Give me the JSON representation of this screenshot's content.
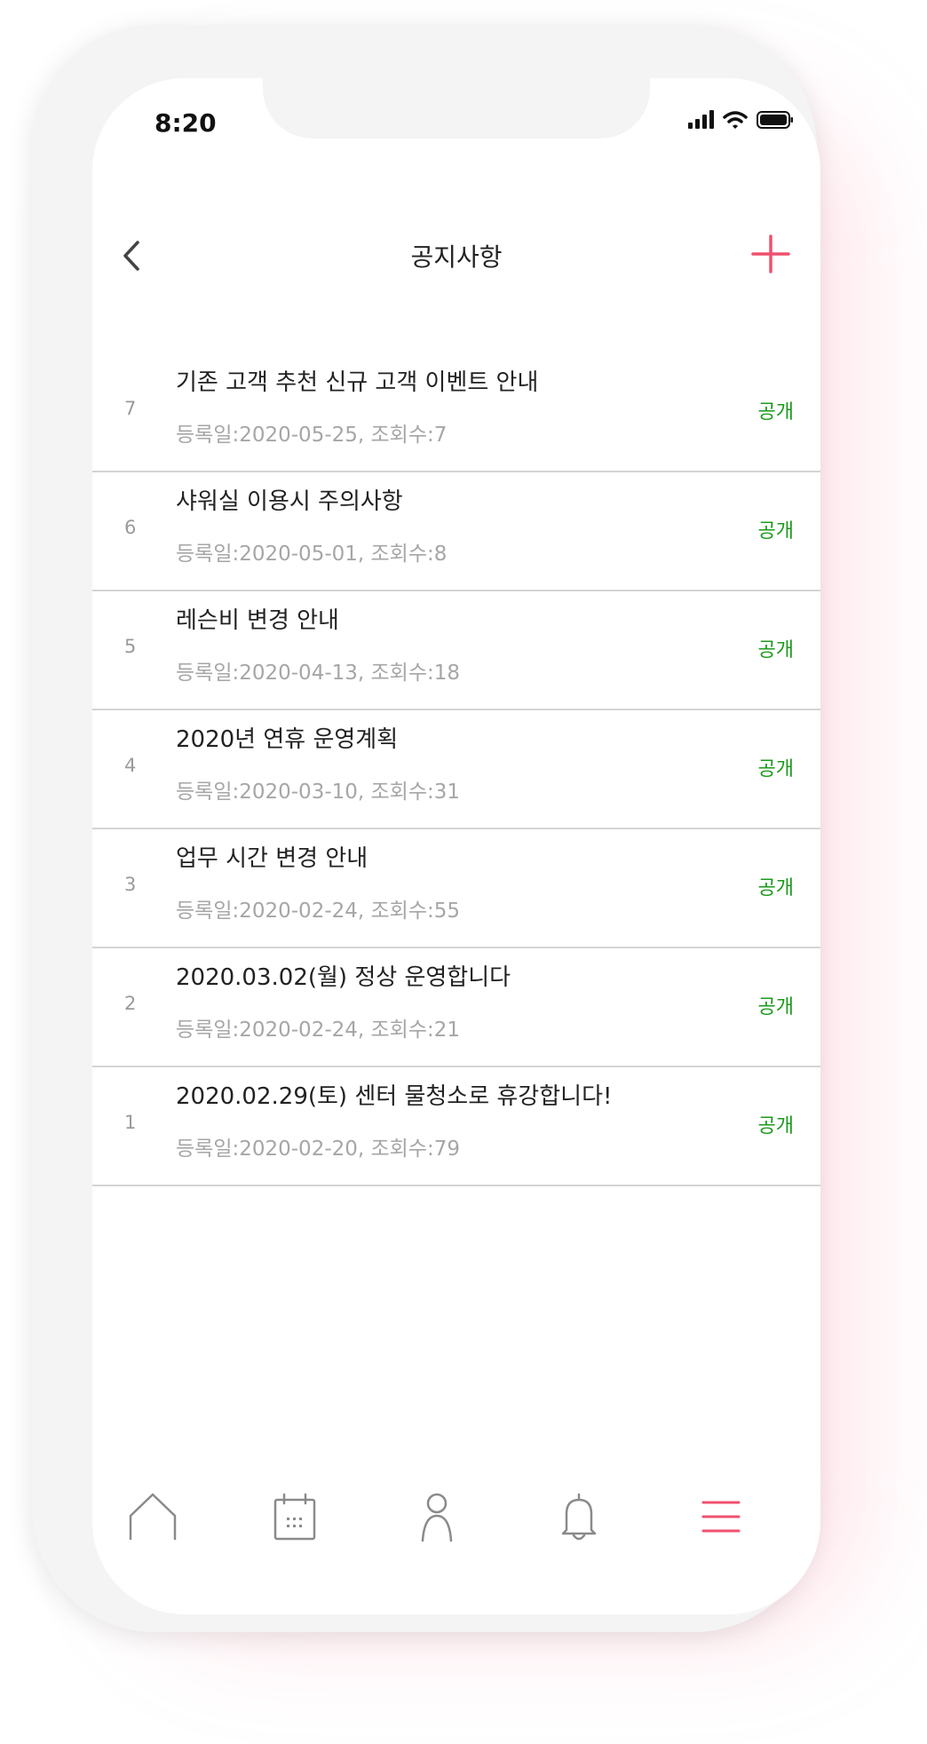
{
  "status_bar": {
    "time": "8:20",
    "icons": [
      "signal-icon",
      "wifi-icon",
      "battery-icon"
    ]
  },
  "header": {
    "title": "공지사항",
    "back_icon": "chevron-left-icon",
    "add_icon": "plus-icon"
  },
  "notices": [
    {
      "number": "7",
      "title": "기존 고객 추천 신규 고객 이벤트 안내",
      "meta": "등록일:2020-05-25, 조회수:7",
      "status": "공개"
    },
    {
      "number": "6",
      "title": "샤워실 이용시 주의사항",
      "meta": "등록일:2020-05-01, 조회수:8",
      "status": "공개"
    },
    {
      "number": "5",
      "title": "레슨비 변경 안내",
      "meta": "등록일:2020-04-13, 조회수:18",
      "status": "공개"
    },
    {
      "number": "4",
      "title": "2020년 연휴 운영계획",
      "meta": "등록일:2020-03-10, 조회수:31",
      "status": "공개"
    },
    {
      "number": "3",
      "title": "업무 시간 변경 안내",
      "meta": "등록일:2020-02-24, 조회수:55",
      "status": "공개"
    },
    {
      "number": "2",
      "title": "2020.03.02(월) 정상 운영합니다",
      "meta": "등록일:2020-02-24, 조회수:21",
      "status": "공개"
    },
    {
      "number": "1",
      "title": "2020.02.29(토) 센터 물청소로 휴강합니다!",
      "meta": "등록일:2020-02-20, 조회수:79",
      "status": "공개"
    }
  ],
  "tab_bar": {
    "items": [
      "home-icon",
      "calendar-icon",
      "person-icon",
      "bell-icon",
      "menu-icon"
    ],
    "active": "menu-icon"
  },
  "colors": {
    "accent": "#f0506e",
    "status_public": "#1b9a1b",
    "icon_gray": "#8a8a8a"
  }
}
